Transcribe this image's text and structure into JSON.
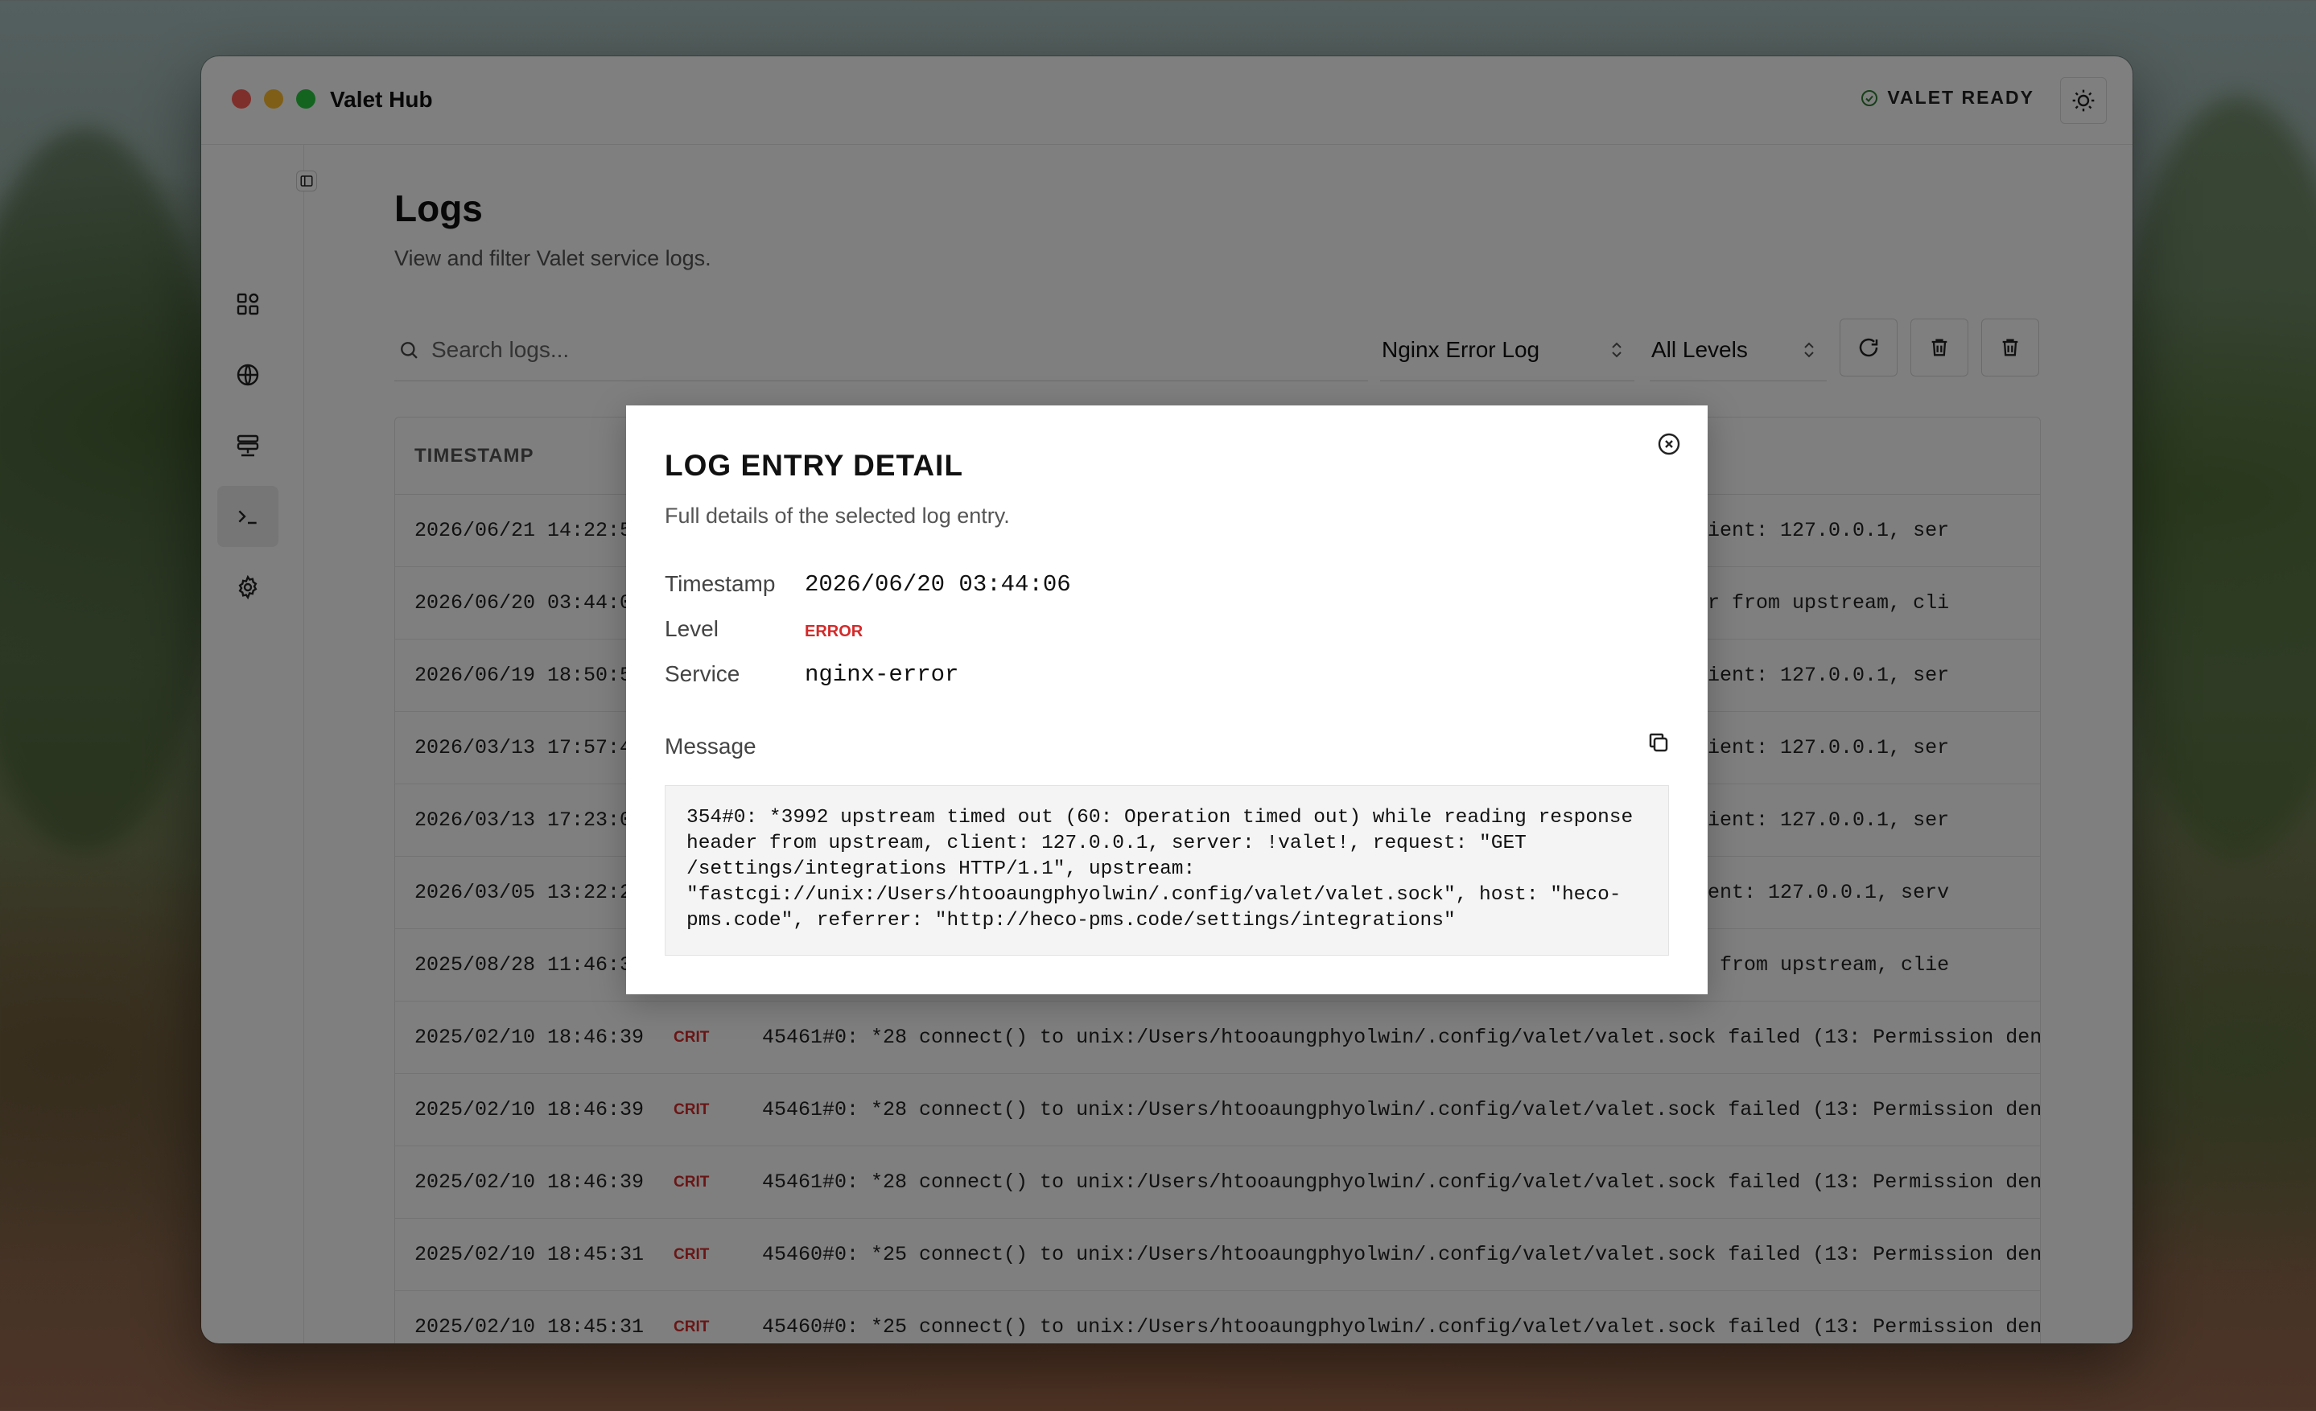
{
  "app": {
    "title": "Valet Hub",
    "status_label": "VALET READY"
  },
  "sidebar": {
    "items": [
      {
        "icon": "dashboard-icon"
      },
      {
        "icon": "globe-icon"
      },
      {
        "icon": "services-icon"
      },
      {
        "icon": "terminal-icon",
        "active": true
      },
      {
        "icon": "gear-icon"
      }
    ]
  },
  "page": {
    "title": "Logs",
    "subtitle": "View and filter Valet service logs."
  },
  "filters": {
    "search_placeholder": "Search logs...",
    "log_source": "Nginx Error Log",
    "level": "All Levels"
  },
  "table": {
    "header_timestamp": "TIMESTAMP",
    "rows": [
      {
        "timestamp": "2026/06/21 14:22:5",
        "level": "",
        "message": "alive, client: 127.0.0.1, ser"
      },
      {
        "timestamp": "2026/06/20 03:44:0",
        "level": "",
        "message": "nse header from upstream, cli"
      },
      {
        "timestamp": "2026/06/19 18:50:5",
        "level": "",
        "message": "alive, client: 127.0.0.1, ser"
      },
      {
        "timestamp": "2026/03/13 17:57:4",
        "level": "",
        "message": "alive, client: 127.0.0.1, ser"
      },
      {
        "timestamp": "2026/03/13 17:23:0",
        "level": "",
        "message": "alive, client: 127.0.0.1, ser"
      },
      {
        "timestamp": "2026/03/05 13:22:2",
        "level": "",
        "message": "live, client: 127.0.0.1, serv"
      },
      {
        "timestamp": "2025/08/28 11:46:3",
        "level": "",
        "message": "se header from upstream, clie"
      },
      {
        "timestamp": "2025/02/10 18:46:39",
        "level": "CRIT",
        "message": "45461#0: *28 connect() to unix:/Users/htooaungphyolwin/.config/valet/valet.sock failed (13: Permission den"
      },
      {
        "timestamp": "2025/02/10 18:46:39",
        "level": "CRIT",
        "message": "45461#0: *28 connect() to unix:/Users/htooaungphyolwin/.config/valet/valet.sock failed (13: Permission den"
      },
      {
        "timestamp": "2025/02/10 18:46:39",
        "level": "CRIT",
        "message": "45461#0: *28 connect() to unix:/Users/htooaungphyolwin/.config/valet/valet.sock failed (13: Permission den"
      },
      {
        "timestamp": "2025/02/10 18:45:31",
        "level": "CRIT",
        "message": "45460#0: *25 connect() to unix:/Users/htooaungphyolwin/.config/valet/valet.sock failed (13: Permission den"
      },
      {
        "timestamp": "2025/02/10 18:45:31",
        "level": "CRIT",
        "message": "45460#0: *25 connect() to unix:/Users/htooaungphyolwin/.config/valet/valet.sock failed (13: Permission den"
      }
    ]
  },
  "modal": {
    "title": "LOG ENTRY DETAIL",
    "subtitle": "Full details of the selected log entry.",
    "timestamp_label": "Timestamp",
    "timestamp_value": "2026/06/20 03:44:06",
    "level_label": "Level",
    "level_value": "ERROR",
    "service_label": "Service",
    "service_value": "nginx-error",
    "message_label": "Message",
    "message_value": "354#0: *3992 upstream timed out (60: Operation timed out) while reading response\nheader from upstream, client: 127.0.0.1, server: !valet!, request: \"GET\n/settings/integrations HTTP/1.1\", upstream:\n\"fastcgi://unix:/Users/htooaungphyolwin/.config/valet/valet.sock\", host: \"heco-\npms.code\", referrer: \"http://heco-pms.code/settings/integrations\""
  },
  "colors": {
    "error": "#d42a2a",
    "status_ok": "#2e7d32"
  }
}
